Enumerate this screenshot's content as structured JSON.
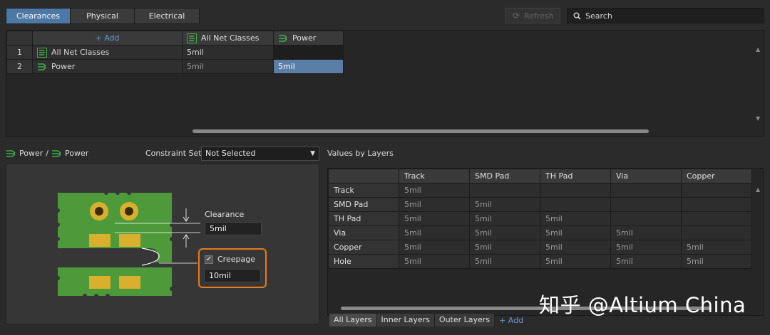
{
  "tabs": [
    "Clearances",
    "Physical",
    "Electrical"
  ],
  "toolbar": {
    "refresh_label": "Refresh",
    "search_label": "Search"
  },
  "matrix": {
    "add_label": "+ Add",
    "col_headers": [
      "All Net Classes",
      "Power"
    ],
    "rows": [
      {
        "num": "1",
        "name": "All Net Classes",
        "values": [
          "5mil",
          ""
        ]
      },
      {
        "num": "2",
        "name": "Power",
        "values": [
          "5mil",
          "5mil"
        ]
      }
    ]
  },
  "breadcrumb": {
    "from": "Power",
    "sep": "/",
    "to": "Power"
  },
  "constraint": {
    "label": "Constraint Set",
    "value": "Not Selected"
  },
  "illustration": {
    "clearance_label": "Clearance",
    "clearance_value": "5mil",
    "creepage_label": "Creepage",
    "creepage_value": "10mil"
  },
  "layers": {
    "title": "Values by Layers",
    "headers": [
      "Track",
      "SMD Pad",
      "TH Pad",
      "Via",
      "Copper"
    ],
    "rows": [
      {
        "label": "Track",
        "values": [
          "5mil",
          "",
          "",
          "",
          ""
        ]
      },
      {
        "label": "SMD Pad",
        "values": [
          "5mil",
          "5mil",
          "",
          "",
          ""
        ]
      },
      {
        "label": "TH Pad",
        "values": [
          "5mil",
          "5mil",
          "5mil",
          "",
          ""
        ]
      },
      {
        "label": "Via",
        "values": [
          "5mil",
          "5mil",
          "5mil",
          "5mil",
          ""
        ]
      },
      {
        "label": "Copper",
        "values": [
          "5mil",
          "5mil",
          "5mil",
          "5mil",
          "5mil"
        ]
      },
      {
        "label": "Hole",
        "values": [
          "5mil",
          "5mil",
          "5mil",
          "5mil",
          "5mil"
        ]
      }
    ],
    "bottom_tabs": [
      "All Layers",
      "Inner Layers",
      "Outer Layers"
    ],
    "add_label": "+ Add"
  },
  "watermark": "知乎 @Altium China",
  "colors": {
    "accent": "#4d77a5",
    "highlight": "#e87a1e",
    "board": "#4e9a3a",
    "pad": "#d9b02e"
  }
}
